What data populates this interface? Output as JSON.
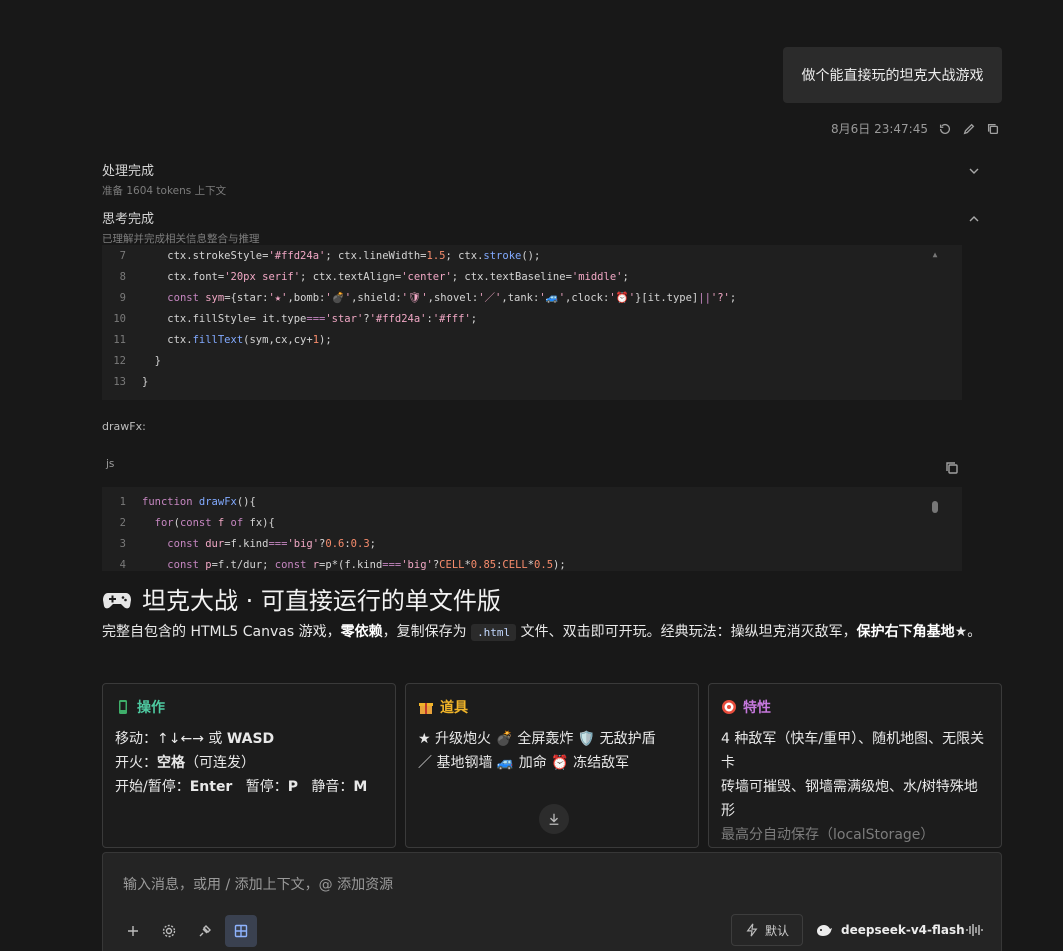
{
  "user_message": {
    "text": "做个能直接玩的坦克大战游戏",
    "timestamp": "8月6日 23:47:45"
  },
  "status": [
    {
      "title": "处理完成",
      "subtitle": "准备 1604 tokens 上下文",
      "icon": "chevron-down-icon"
    },
    {
      "title": "思考完成",
      "subtitle": "已理解并完成相关信息整合与推理",
      "icon": "chevron-up-icon"
    }
  ],
  "code_block_1": {
    "line_numbers": [
      "7",
      "8",
      "9",
      "10",
      "11",
      "12",
      "13"
    ]
  },
  "label_drawfx": "drawFx:",
  "code_block_2": {
    "lang": "js",
    "line_numbers": [
      "1",
      "2",
      "3",
      "4"
    ]
  },
  "section": {
    "title": "坦克大战 · 可直接运行的单文件版",
    "title_icon": "gamepad-icon",
    "intro_1": "完整自包含的 HTML5 Canvas 游戏，",
    "intro_b1": "零依赖",
    "intro_2": "，复制保存为 ",
    "intro_code": ".html",
    "intro_3": " 文件、双击即可开玩。经典玩法：操纵坦克消灭敌军，",
    "intro_b2": "保护右下角基地",
    "intro_4": "★。"
  },
  "cards": {
    "controls": {
      "title": "操作",
      "color": "#4ec9a0",
      "icon": "phone-icon",
      "move_label": "移动：",
      "move_keys": "↑↓←→ 或 ",
      "move_wasd": "WASD",
      "fire_label": "开火：",
      "fire_key": "空格",
      "fire_note": "（可连发）",
      "start_label": "开始/暂停：",
      "start_key": "Enter",
      "pause_label": "暂停：",
      "pause_key": "P",
      "mute_label": "静音：",
      "mute_key": "M"
    },
    "items": {
      "title": "道具",
      "color": "#f0b429",
      "icon": "gift-icon",
      "line1": "★ 升级炮火  💣 全屏轰炸  🛡️ 无敌护盾",
      "line2": "／ 基地钢墙  🚙 加命  ⏰ 冻结敌军"
    },
    "features": {
      "title": "特性",
      "color": "#c678dd",
      "icon": "target-icon",
      "line1": "4 种敌军（快车/重甲）、随机地图、无限关卡",
      "line2": "砖墙可摧毁、钢墙需满级炮、水/树特殊地形",
      "line3": "最高分自动保存（localStorage）"
    }
  },
  "composer": {
    "placeholder": "输入消息，或用 / 添加上下文，@ 添加资源",
    "mode_label": "默认",
    "model_name": "deepseek-v4-flash"
  },
  "colors": {
    "background": "#181818",
    "panel": "#242424",
    "accent": "#3a4150"
  }
}
